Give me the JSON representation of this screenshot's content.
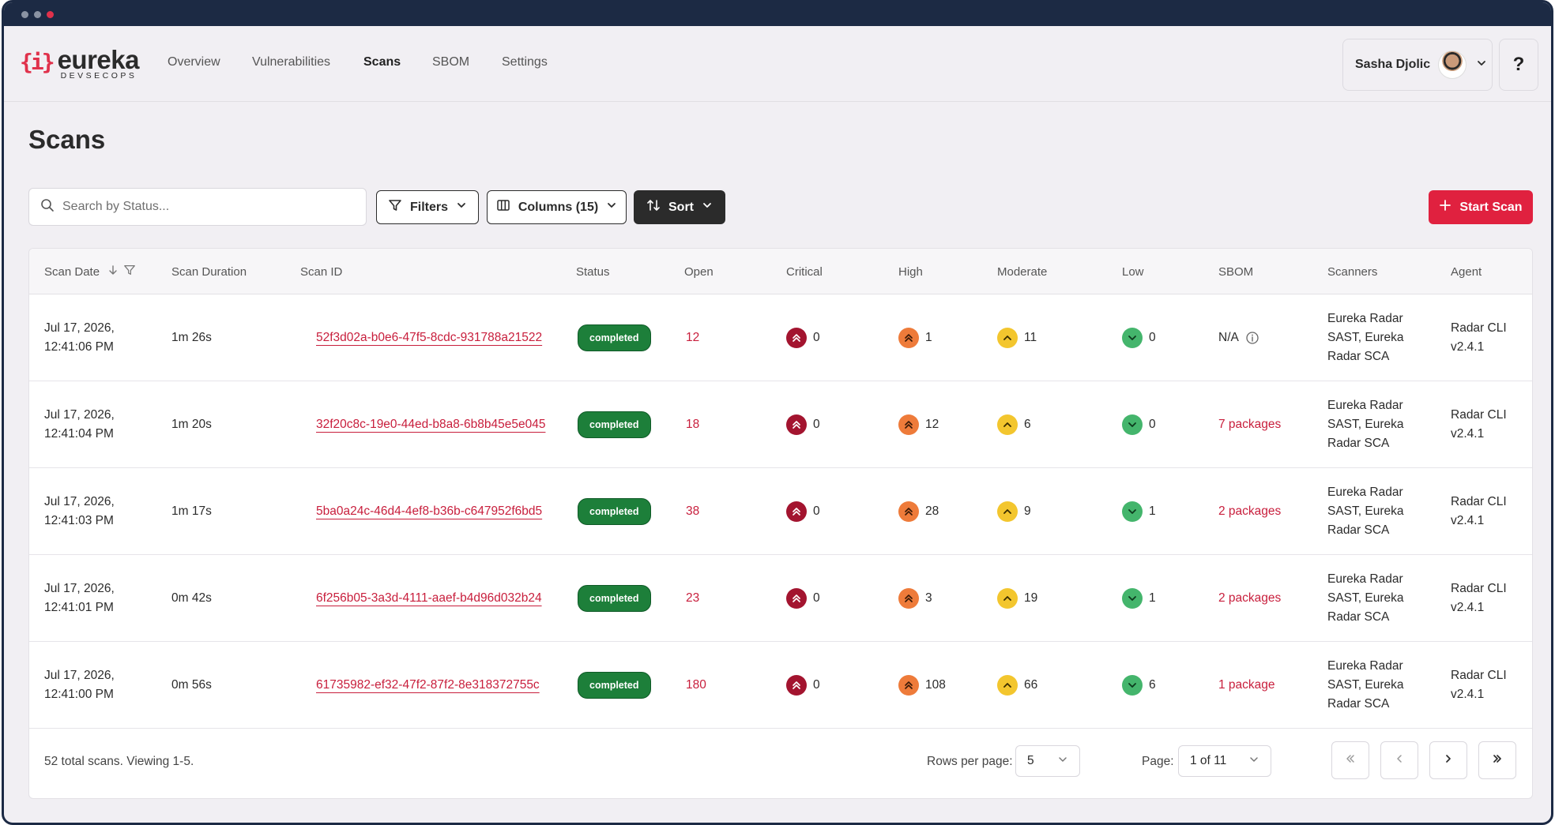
{
  "window": {
    "controls": [
      "close",
      "minimize",
      "maximize"
    ]
  },
  "brand": {
    "mark": "{i}",
    "name": "eureka",
    "tagline": "DEVSECOPS",
    "accent": "#e0314b"
  },
  "nav": [
    {
      "label": "Overview",
      "active": false
    },
    {
      "label": "Vulnerabilities",
      "active": false
    },
    {
      "label": "Scans",
      "active": true
    },
    {
      "label": "SBOM",
      "active": false
    },
    {
      "label": "Settings",
      "active": false
    }
  ],
  "user": {
    "name": "Sasha Djolic",
    "help_label": "?"
  },
  "page": {
    "title": "Scans"
  },
  "toolbar": {
    "search_placeholder": "Search by Status...",
    "filters_label": "Filters",
    "columns_label": "Columns (15)",
    "sort_label": "Sort",
    "start_scan_label": "Start Scan"
  },
  "table": {
    "columns": [
      "Scan Date",
      "Scan Duration",
      "Scan ID",
      "Status",
      "Open",
      "Critical",
      "High",
      "Moderate",
      "Low",
      "SBOM",
      "Scanners",
      "Agent"
    ],
    "rows": [
      {
        "date": "Jul 17, 2026,",
        "time": "12:41:06 PM",
        "duration": "1m 26s",
        "id": "52f3d02a-b0e6-47f5-8cdc-931788a21522",
        "status": "completed",
        "open": "12",
        "critical": "0",
        "high": "1",
        "moderate": "11",
        "low": "0",
        "sbom": "N/A",
        "sbom_link": false,
        "scanners": [
          "Eureka Radar",
          "SAST, Eureka",
          "Radar SCA"
        ],
        "agent": [
          "Radar CLI",
          "v2.4.1"
        ]
      },
      {
        "date": "Jul 17, 2026,",
        "time": "12:41:04 PM",
        "duration": "1m 20s",
        "id": "32f20c8c-19e0-44ed-b8a8-6b8b45e5e045",
        "status": "completed",
        "open": "18",
        "critical": "0",
        "high": "12",
        "moderate": "6",
        "low": "0",
        "sbom": "7 packages",
        "sbom_link": true,
        "scanners": [
          "Eureka Radar",
          "SAST, Eureka",
          "Radar SCA"
        ],
        "agent": [
          "Radar CLI",
          "v2.4.1"
        ]
      },
      {
        "date": "Jul 17, 2026,",
        "time": "12:41:03 PM",
        "duration": "1m 17s",
        "id": "5ba0a24c-46d4-4ef8-b36b-c647952f6bd5",
        "status": "completed",
        "open": "38",
        "critical": "0",
        "high": "28",
        "moderate": "9",
        "low": "1",
        "sbom": "2 packages",
        "sbom_link": true,
        "scanners": [
          "Eureka Radar",
          "SAST, Eureka",
          "Radar SCA"
        ],
        "agent": [
          "Radar CLI",
          "v2.4.1"
        ]
      },
      {
        "date": "Jul 17, 2026,",
        "time": "12:41:01 PM",
        "duration": "0m 42s",
        "id": "6f256b05-3a3d-4111-aaef-b4d96d032b24",
        "status": "completed",
        "open": "23",
        "critical": "0",
        "high": "3",
        "moderate": "19",
        "low": "1",
        "sbom": "2 packages",
        "sbom_link": true,
        "scanners": [
          "Eureka Radar",
          "SAST, Eureka",
          "Radar SCA"
        ],
        "agent": [
          "Radar CLI",
          "v2.4.1"
        ]
      },
      {
        "date": "Jul 17, 2026,",
        "time": "12:41:00 PM",
        "duration": "0m 56s",
        "id": "61735982-ef32-47f2-87f2-8e318372755c",
        "status": "completed",
        "open": "180",
        "critical": "0",
        "high": "108",
        "moderate": "66",
        "low": "6",
        "sbom": "1 package",
        "sbom_link": true,
        "scanners": [
          "Eureka Radar",
          "SAST, Eureka",
          "Radar SCA"
        ],
        "agent": [
          "Radar CLI",
          "v2.4.1"
        ]
      }
    ]
  },
  "footer": {
    "summary": "52 total scans. Viewing 1-5.",
    "rows_per_page_label": "Rows per page:",
    "rows_per_page_value": "5",
    "page_label": "Page:",
    "page_value": "1 of 11"
  },
  "colors": {
    "critical": "#a3142f",
    "high": "#ee7b3a",
    "moderate": "#f3c62e",
    "low": "#44b56c",
    "status_completed": "#1d7f3a",
    "link": "#c81e3c",
    "primary_button": "#e0213f",
    "dark_button": "#2b2b2b"
  },
  "icons": [
    "search-icon",
    "filter-icon",
    "columns-icon",
    "sort-icon",
    "chevron-down-icon",
    "plus-icon",
    "arrow-down-icon",
    "info-icon",
    "chevrons-up-icon",
    "chevron-up-icon",
    "first-page-icon",
    "prev-page-icon",
    "next-page-icon",
    "last-page-icon"
  ]
}
